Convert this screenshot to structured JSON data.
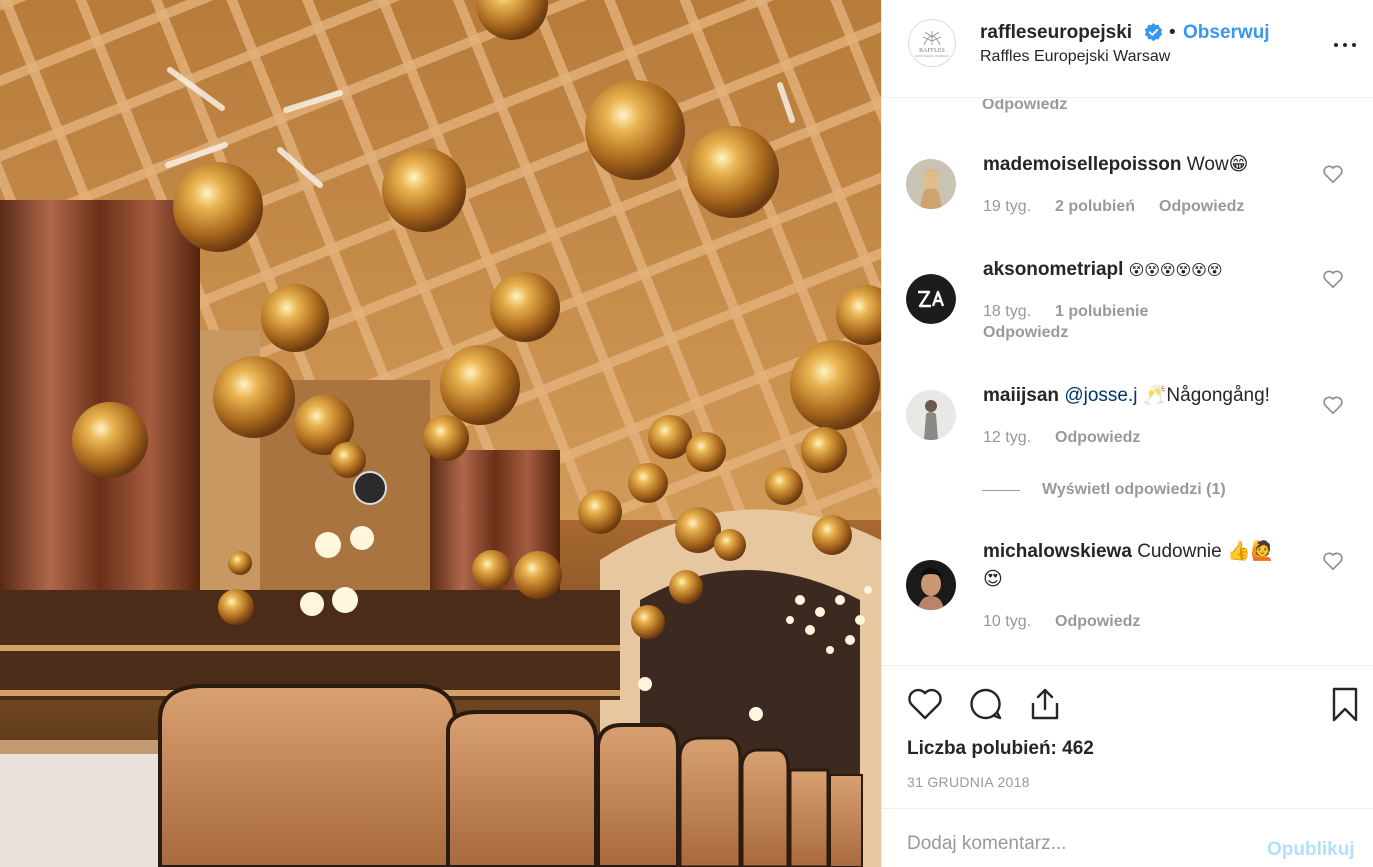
{
  "post": {
    "username": "raffleseuropejski",
    "follow_label": "Obserwuj",
    "location": "Raffles Europejski Warsaw",
    "logo_text": "RAFFLES",
    "logo_subtext": "EUROPEJSKI WARSAW",
    "verified": true,
    "accent_color": "#3897f0"
  },
  "comments": {
    "previous_reply_label": "Odpowiedz",
    "items": [
      {
        "username": "mademoiselle​poisson",
        "text": "Wow😁",
        "age": "19 tyg.",
        "likes": "2 polubień",
        "reply": "Odpowiedz"
      },
      {
        "username": "aksonometriapl",
        "text": "😵😵😵😵😵😵",
        "age": "18 tyg.",
        "likes": "1 polubienie",
        "reply": "Odpowiedz"
      },
      {
        "username": "maiijsan",
        "mention": "@josse.j",
        "text": "🥂Någongång!",
        "age": "12 tyg.",
        "reply": "Odpowiedz"
      },
      {
        "username": "michalowskiewa",
        "text": "Cudownie 👍🙋",
        "text2": "😍",
        "age": "10 tyg.",
        "reply": "Odpowiedz"
      }
    ],
    "view_replies": "Wyświetl odpowiedzi (1)"
  },
  "actions": {
    "likes": "Liczba polubień: 462",
    "date": "31 GRUDNIA 2018"
  },
  "composer": {
    "placeholder": "Dodaj komentarz...",
    "publish": "Opublikuj"
  }
}
